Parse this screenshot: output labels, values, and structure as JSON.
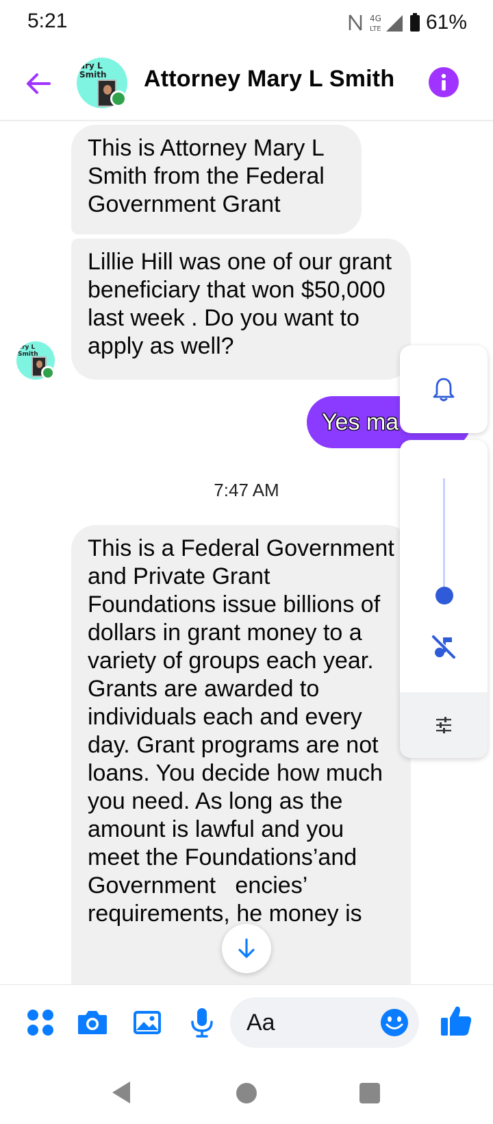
{
  "status_bar": {
    "time": "5:21",
    "network": "4G LTE",
    "battery": "61%"
  },
  "header": {
    "contact_name": "Attorney Mary L Smith",
    "avatar_text": "ary L\nSmith"
  },
  "messages": [
    {
      "direction": "incoming",
      "text": "This is Attorney Mary L Smith from the Federal Government Grant"
    },
    {
      "direction": "incoming",
      "text": "Lillie Hill was one of our grant beneficiary that won $50,000 last week . Do you want to apply as well?"
    },
    {
      "direction": "outgoing",
      "text": "Yes ma"
    },
    {
      "direction": "incoming",
      "text": "This is a Federal Government and Private Grant Foundations issue billions of dollars in grant money to a variety of groups each year. Grants are awarded to individuals each and every day. Grant programs are not loans. You decide how much you need. As long as the amount is lawful and you meet the Foundations’and Government   encies’ requirements, he money is"
    }
  ],
  "timestamp": "7:47 AM",
  "volume": {
    "level_fraction": 0.0,
    "muted": true
  },
  "composer": {
    "placeholder": "Aa"
  },
  "icons": {
    "back": "arrow-left-icon",
    "info": "info-icon",
    "bell": "bell-icon",
    "mute": "music-off-icon",
    "equalizer": "sliders-icon",
    "apps": "grid-dots-icon",
    "camera": "camera-icon",
    "gallery": "image-icon",
    "mic": "microphone-icon",
    "emoji": "emoji-icon",
    "like": "thumbs-up-icon"
  },
  "colors": {
    "accent_purple": "#a033ff",
    "messenger_blue": "#0a7cff",
    "outgoing_bubble": "#8a3bff",
    "incoming_bubble": "#f0f0f0",
    "online": "#31a24c"
  }
}
